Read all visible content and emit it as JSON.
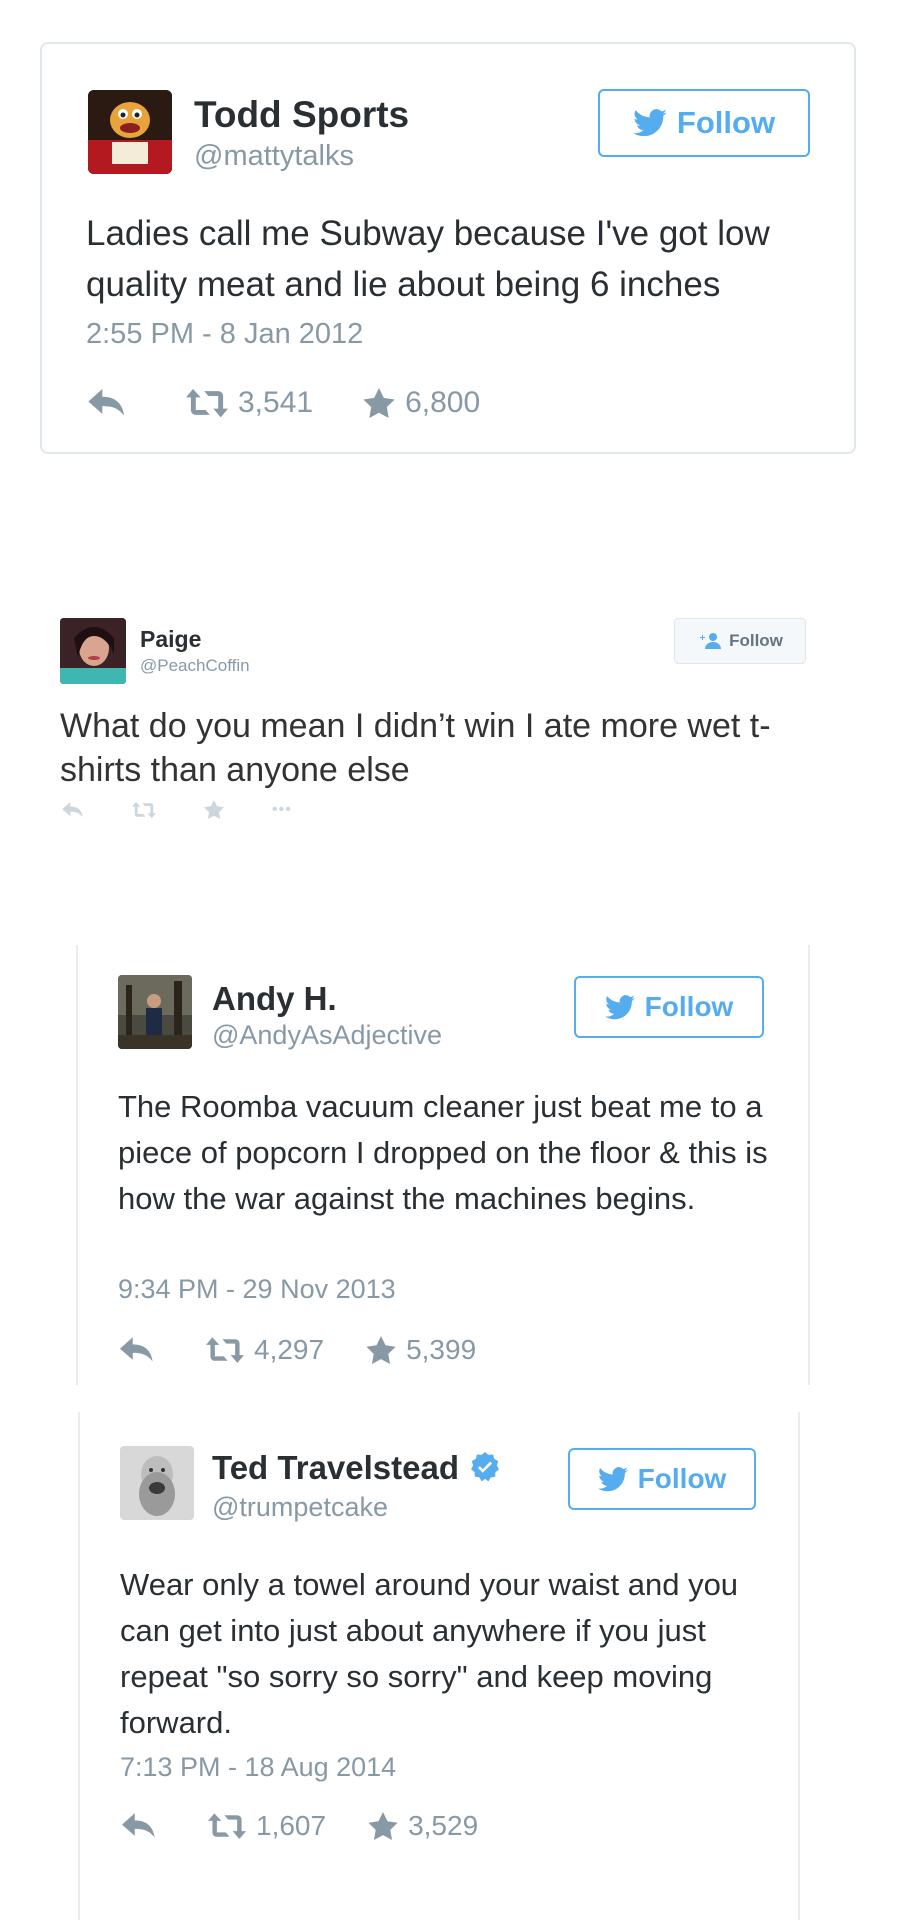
{
  "tweets": [
    {
      "name": "Todd Sports",
      "handle": "@mattytalks",
      "follow_label": "Follow",
      "text": "Ladies call me Subway because I've got low quality meat and lie about being 6 inches",
      "timestamp": "2:55 PM - 8 Jan 2012",
      "retweets": "3,541",
      "favorites": "6,800"
    },
    {
      "name": "Paige",
      "handle": "@PeachCoffin",
      "follow_label": "Follow",
      "text": "What do you mean I didn’t win I ate more wet t-shirts than anyone else",
      "more": "•••"
    },
    {
      "name": "Andy H.",
      "handle": "@AndyAsAdjective",
      "follow_label": "Follow",
      "text": "The Roomba vacuum cleaner just beat me to a piece of popcorn I dropped on the floor & this is how the war against the machines begins.",
      "timestamp": "9:34 PM - 29 Nov 2013",
      "retweets": "4,297",
      "favorites": "5,399"
    },
    {
      "name": "Ted Travelstead",
      "handle": "@trumpetcake",
      "follow_label": "Follow",
      "text": "Wear only a towel around your waist and you can get into just about anywhere if you just repeat \"so sorry so sorry\" and keep moving forward.",
      "timestamp": "7:13 PM - 18 Aug 2014",
      "retweets": "1,607",
      "favorites": "3,529"
    }
  ],
  "colors": {
    "twitter_blue": "#55acee",
    "muted_gray": "#8899a6",
    "text_dark": "#292f33",
    "border": "#e1e8ed"
  },
  "icons": [
    "twitter-bird-icon",
    "reply-icon",
    "retweet-icon",
    "favorite-star-icon",
    "add-user-icon",
    "verified-badge-icon",
    "more-icon"
  ]
}
